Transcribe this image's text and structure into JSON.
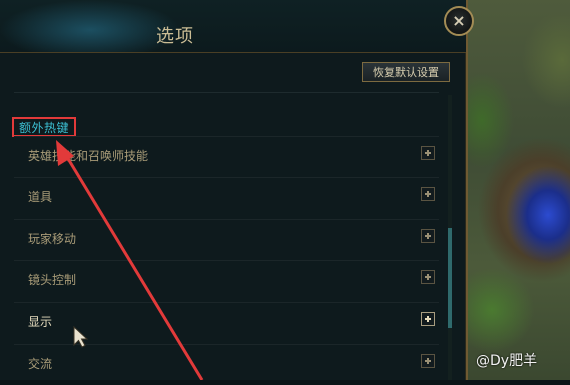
{
  "dialog": {
    "title": "选项",
    "reset_label": "恢复默认设置",
    "close_icon": "×"
  },
  "section": {
    "title": "额外热键"
  },
  "items": [
    {
      "label": "英雄技能和召唤师技能",
      "bright": false
    },
    {
      "label": "道具",
      "bright": false
    },
    {
      "label": "玩家移动",
      "bright": false
    },
    {
      "label": "镜头控制",
      "bright": false
    },
    {
      "label": "显示",
      "bright": true
    },
    {
      "label": "交流",
      "bright": false
    }
  ],
  "watermark": "@Dy肥羊",
  "colors": {
    "highlight_border": "#e23a3a",
    "section_title": "#3cbfd2",
    "frame_gold": "#a38c55"
  }
}
